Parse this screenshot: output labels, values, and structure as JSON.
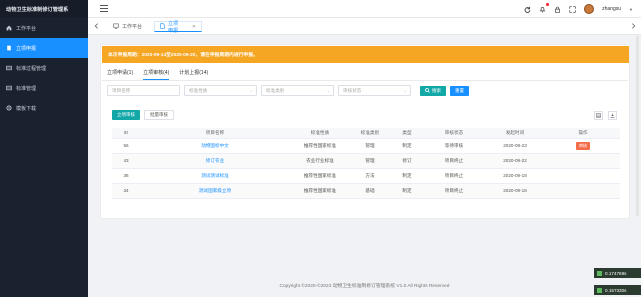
{
  "app": {
    "title": "动物卫生标准制修订管理系"
  },
  "sidebar": {
    "items": [
      {
        "label": "工作平台",
        "icon": "home-icon",
        "active": false
      },
      {
        "label": "立项申报",
        "icon": "document-icon",
        "active": true
      },
      {
        "label": "标准过程管理",
        "icon": "list-icon",
        "active": false
      },
      {
        "label": "标准管理",
        "icon": "list-icon",
        "active": false
      },
      {
        "label": "模板下载",
        "icon": "gear-icon",
        "active": false
      }
    ]
  },
  "topbar": {
    "username": "zhangsu"
  },
  "tabs": {
    "home": "工作平台",
    "active": "立项申报"
  },
  "notice": "本次申报周期：2020-09-14至2020-09-20，请在申报周期内进行申报。",
  "subtabs": [
    {
      "label": "立项申请(1)",
      "active": false
    },
    {
      "label": "立项审核(4)",
      "active": true
    },
    {
      "label": "计划上报(14)",
      "active": false
    }
  ],
  "filters": {
    "name_placeholder": "项目名称",
    "nature_placeholder": "标准性质",
    "category_placeholder": "标准类别",
    "status_placeholder": "审核状态",
    "search_label": "搜索",
    "reset_label": "重置"
  },
  "actions": {
    "add_label": "立项审核",
    "other_label": "批量审核"
  },
  "table": {
    "headers": [
      "ID",
      "项目名称",
      "标准性质",
      "标准类别",
      "类型",
      "审核状态",
      "发起时间",
      "操作"
    ],
    "rows": [
      {
        "id": "56",
        "name": "动物国标中文",
        "nature": "推荐性国家标准",
        "category": "管理",
        "type": "制定",
        "status": "等待审核",
        "date": "2020-09-23",
        "op": "审核"
      },
      {
        "id": "43",
        "name": "修订农业",
        "nature": "农业行业标准",
        "category": "管理",
        "type": "修订",
        "status": "项目终止",
        "date": "2020-09-22",
        "op": ""
      },
      {
        "id": "36",
        "name": "测试测试标准",
        "nature": "推荐性国家标准",
        "category": "方法",
        "type": "制定",
        "status": "项目终止",
        "date": "2020-09-18",
        "op": ""
      },
      {
        "id": "34",
        "name": "测试国家级立项",
        "nature": "推荐性国家标准",
        "category": "基础",
        "type": "制定",
        "status": "项目终止",
        "date": "2020-09-18",
        "op": ""
      }
    ]
  },
  "footer": "Copyright ©2020-©2022 动物卫生标准制修订管理系统 V1.0 All Rights Reserved",
  "timers": [
    "0.174769s",
    "0.157330s"
  ]
}
